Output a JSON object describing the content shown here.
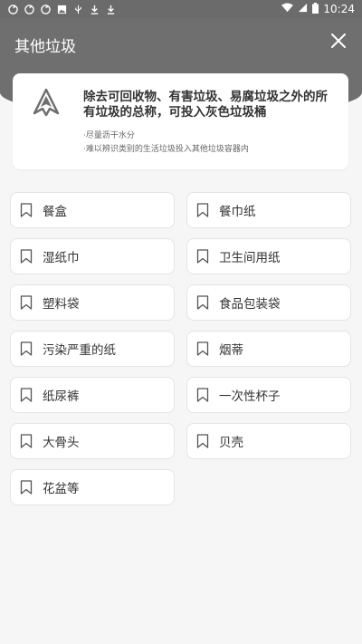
{
  "status_bar": {
    "time": "10:24",
    "left_icons": [
      "sync-icon",
      "sync-icon",
      "sync-icon",
      "image-icon",
      "usb-icon",
      "download-icon",
      "download-icon"
    ],
    "right_icons": [
      "wifi-icon",
      "signal-icon",
      "battery-icon"
    ]
  },
  "header": {
    "title": "其他垃圾",
    "close_icon": "close-icon",
    "background": "#6f6f6f"
  },
  "info": {
    "logo_icon": "recycle-logo-icon",
    "description": "除去可回收物、有害垃圾、易腐垃圾之外的所有垃圾的总称，可投入灰色垃圾桶",
    "tips": [
      "·尽量沥干水分",
      "·难以辨识类别的生活垃圾投入其他垃圾容器内"
    ]
  },
  "items": [
    {
      "label": "餐盒",
      "icon": "bookmark-icon"
    },
    {
      "label": "餐巾纸",
      "icon": "bookmark-icon"
    },
    {
      "label": "湿纸巾",
      "icon": "bookmark-icon"
    },
    {
      "label": "卫生间用纸",
      "icon": "bookmark-icon"
    },
    {
      "label": "塑料袋",
      "icon": "bookmark-icon"
    },
    {
      "label": "食品包装袋",
      "icon": "bookmark-icon"
    },
    {
      "label": "污染严重的纸",
      "icon": "bookmark-icon"
    },
    {
      "label": "烟蒂",
      "icon": "bookmark-icon"
    },
    {
      "label": "纸尿裤",
      "icon": "bookmark-icon"
    },
    {
      "label": "一次性杯子",
      "icon": "bookmark-icon"
    },
    {
      "label": "大骨头",
      "icon": "bookmark-icon"
    },
    {
      "label": "贝壳",
      "icon": "bookmark-icon"
    },
    {
      "label": "花盆等",
      "icon": "bookmark-icon"
    }
  ]
}
